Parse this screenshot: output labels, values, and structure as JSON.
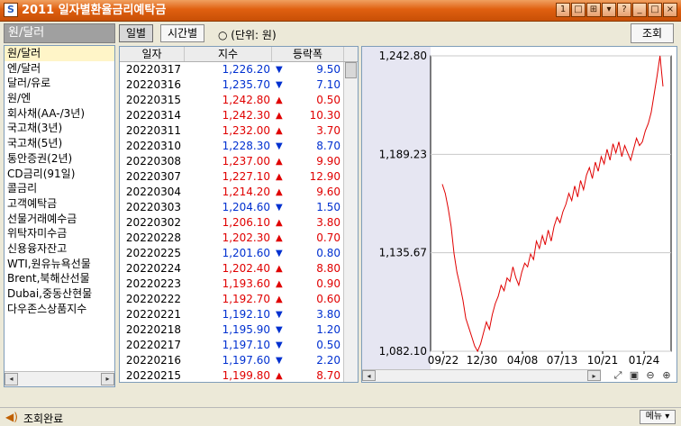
{
  "window": {
    "title": "2011 일자별환율금리예탁금",
    "controls": [
      "1",
      "□",
      "⊞",
      "▾",
      "?",
      "_",
      "□",
      "×"
    ]
  },
  "left": {
    "header": "원/달러",
    "items": [
      "원/달러",
      "엔/달러",
      "달러/유로",
      "원/엔",
      "회사채(AA-/3년)",
      "국고채(3년)",
      "국고채(5년)",
      "통안증권(2년)",
      "CD금리(91일)",
      "콜금리",
      "고객예탁금",
      "선물거래예수금",
      "위탁자미수금",
      "신용융자잔고",
      "WTI,원유뉴욕선물",
      "Brent,북해산선물",
      "Dubai,중동산현물",
      "다우존스상품지수"
    ],
    "selected_index": 0
  },
  "toolbar": {
    "tab_daily": "일별",
    "tab_hourly": "시간별",
    "unit": "○ (단위: 원)",
    "query": "조회"
  },
  "table": {
    "headers": [
      "일자",
      "지수",
      "등락폭"
    ],
    "rows": [
      {
        "date": "20220317",
        "value": "1,226.20",
        "dir": "down",
        "change": "9.50"
      },
      {
        "date": "20220316",
        "value": "1,235.70",
        "dir": "down",
        "change": "7.10"
      },
      {
        "date": "20220315",
        "value": "1,242.80",
        "dir": "up",
        "change": "0.50"
      },
      {
        "date": "20220314",
        "value": "1,242.30",
        "dir": "up",
        "change": "10.30"
      },
      {
        "date": "20220311",
        "value": "1,232.00",
        "dir": "up",
        "change": "3.70"
      },
      {
        "date": "20220310",
        "value": "1,228.30",
        "dir": "down",
        "change": "8.70"
      },
      {
        "date": "20220308",
        "value": "1,237.00",
        "dir": "up",
        "change": "9.90"
      },
      {
        "date": "20220307",
        "value": "1,227.10",
        "dir": "up",
        "change": "12.90"
      },
      {
        "date": "20220304",
        "value": "1,214.20",
        "dir": "up",
        "change": "9.60"
      },
      {
        "date": "20220303",
        "value": "1,204.60",
        "dir": "down",
        "change": "1.50"
      },
      {
        "date": "20220302",
        "value": "1,206.10",
        "dir": "up",
        "change": "3.80"
      },
      {
        "date": "20220228",
        "value": "1,202.30",
        "dir": "up",
        "change": "0.70"
      },
      {
        "date": "20220225",
        "value": "1,201.60",
        "dir": "down",
        "change": "0.80"
      },
      {
        "date": "20220224",
        "value": "1,202.40",
        "dir": "up",
        "change": "8.80"
      },
      {
        "date": "20220223",
        "value": "1,193.60",
        "dir": "up",
        "change": "0.90"
      },
      {
        "date": "20220222",
        "value": "1,192.70",
        "dir": "up",
        "change": "0.60"
      },
      {
        "date": "20220221",
        "value": "1,192.10",
        "dir": "down",
        "change": "3.80"
      },
      {
        "date": "20220218",
        "value": "1,195.90",
        "dir": "down",
        "change": "1.20"
      },
      {
        "date": "20220217",
        "value": "1,197.10",
        "dir": "down",
        "change": "0.50"
      },
      {
        "date": "20220216",
        "value": "1,197.60",
        "dir": "down",
        "change": "2.20"
      },
      {
        "date": "20220215",
        "value": "1,199.80",
        "dir": "up",
        "change": "8.70"
      }
    ]
  },
  "chart_data": {
    "type": "line",
    "color": "#e00000",
    "y_ticks": [
      "1,242.80",
      "1,189.23",
      "1,135.67",
      "1,082.10"
    ],
    "y_tick_values": [
      1242.8,
      1189.23,
      1135.67,
      1082.1
    ],
    "x_tick_labels": [
      "09/22",
      "12/30",
      "04/08",
      "07/13",
      "10/21",
      "01/24"
    ],
    "ylim": [
      1082.1,
      1242.8
    ],
    "grid": true,
    "series": [
      {
        "values": [
          1173,
          1168,
          1160,
          1150,
          1135,
          1125,
          1118,
          1110,
          1100,
          1095,
          1090,
          1085,
          1082.1,
          1086,
          1092,
          1098,
          1094,
          1102,
          1108,
          1112,
          1118,
          1115,
          1122,
          1120,
          1128,
          1122,
          1118,
          1125,
          1130,
          1128,
          1135,
          1132,
          1142,
          1138,
          1145,
          1140,
          1148,
          1142,
          1150,
          1155,
          1152,
          1158,
          1162,
          1168,
          1164,
          1172,
          1166,
          1175,
          1170,
          1178,
          1182,
          1176,
          1185,
          1180,
          1188,
          1184,
          1192,
          1186,
          1195,
          1190,
          1196,
          1188,
          1194,
          1190,
          1186,
          1192,
          1198,
          1194,
          1196,
          1202,
          1206,
          1212,
          1222,
          1232,
          1242.8,
          1226.2
        ]
      }
    ]
  },
  "status": {
    "text": "조회완료",
    "menu": "메뉴 ▾"
  }
}
